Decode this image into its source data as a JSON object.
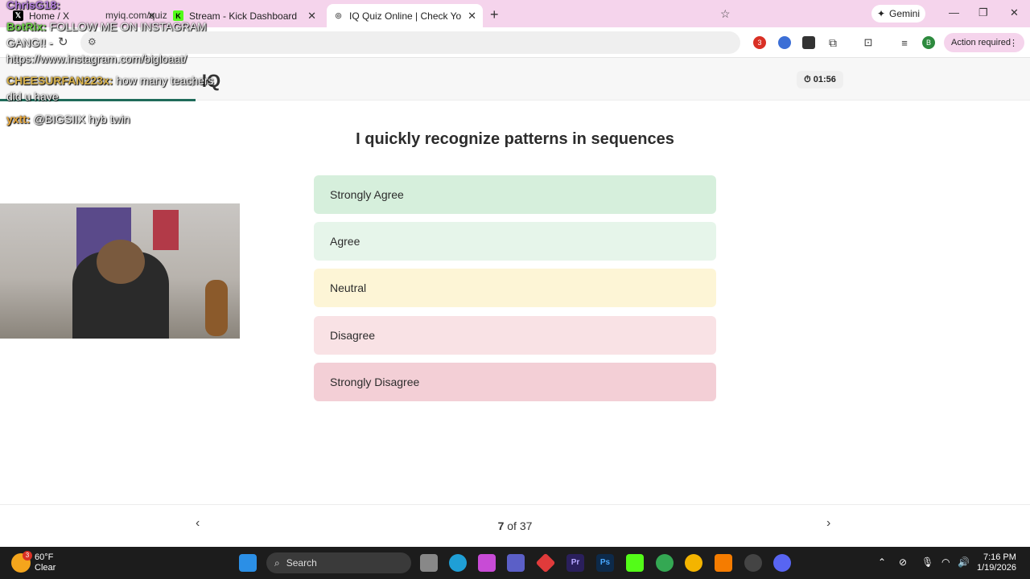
{
  "browser": {
    "tabs": [
      {
        "title": "Home / X",
        "icon": "x-logo-icon"
      },
      {
        "title": "Stream - Kick Dashboard",
        "icon": "kick-logo-icon"
      },
      {
        "title": "IQ Quiz Online | Check Your IQ",
        "icon": "globe-icon"
      }
    ],
    "gemini_label": "Gemini",
    "url": "myiq.com/quiz",
    "action_required": "Action required",
    "ext_badge": "3",
    "profile_initial": "B"
  },
  "page": {
    "logo": "IQ",
    "timer": "01:56",
    "progress_fraction": 0.19,
    "question": "I quickly recognize patterns in sequences",
    "options": [
      {
        "label": "Strongly Agree",
        "color": "#d6efdc"
      },
      {
        "label": "Agree",
        "color": "#e6f5ea"
      },
      {
        "label": "Neutral",
        "color": "#fdf5d6"
      },
      {
        "label": "Disagree",
        "color": "#f9e2e5"
      },
      {
        "label": "Strongly Disagree",
        "color": "#f3cfd6"
      }
    ],
    "counter_current": "7",
    "counter_sep": "of",
    "counter_total": "37"
  },
  "overlay": {
    "chat": [
      {
        "user": "ChrisG18:",
        "msg": "",
        "color": "#b07bd9"
      },
      {
        "user": "BotRix:",
        "msg": "FOLLOW ME ON INSTAGRAM",
        "color": "#6fcf4b"
      },
      {
        "user": "",
        "msg": "GANG!! -",
        "color": "#fff"
      },
      {
        "user": "",
        "msg": "https://www.instagram.com/bigloaat/",
        "color": "#fff"
      },
      {
        "user": "CHEESURFAN223x:",
        "msg": "how many teachers",
        "color": "#d9b24a"
      },
      {
        "user": "",
        "msg": "did u have",
        "color": "#fff"
      },
      {
        "user": "yxtt:",
        "msg": "@BIGSIIX hyb twin",
        "color": "#e8a83c"
      }
    ]
  },
  "taskbar": {
    "weather_temp": "60°F",
    "weather_desc": "Clear",
    "weather_badge": "3",
    "search_label": "Search",
    "time": "7:16 PM",
    "date": "1/19/2026"
  }
}
